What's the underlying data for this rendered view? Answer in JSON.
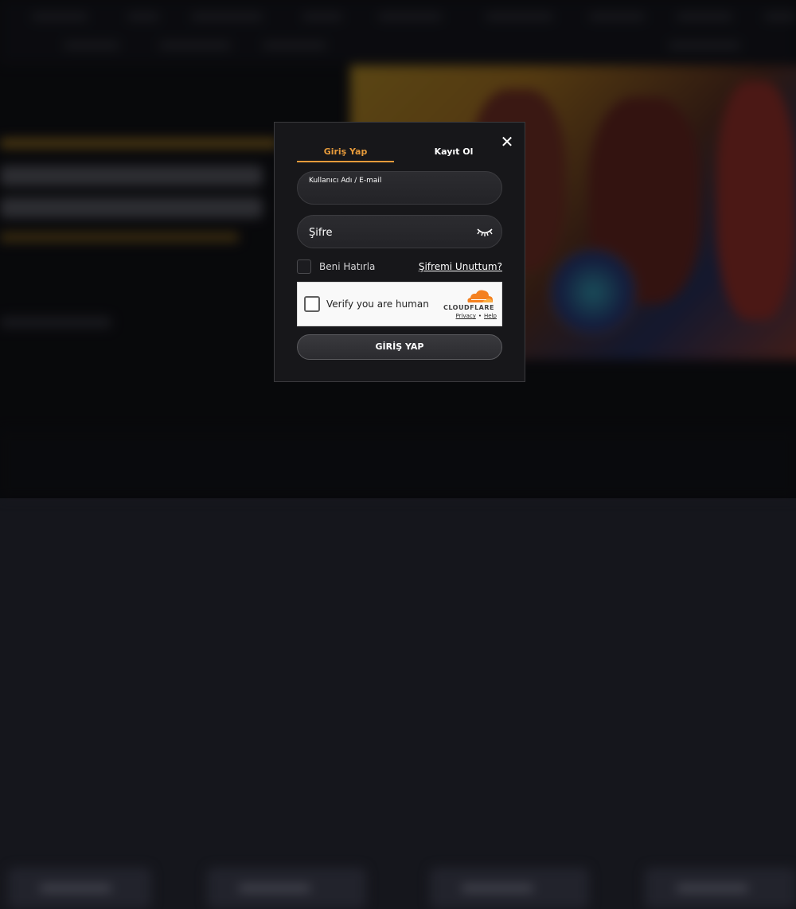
{
  "modal": {
    "tabs": [
      {
        "label": "Giriş Yap",
        "active": true
      },
      {
        "label": "Kayıt Ol",
        "active": false
      }
    ],
    "close_icon": "close-icon",
    "username_field": {
      "label": "Kullanıcı Adı / E-mail",
      "value": ""
    },
    "password_field": {
      "placeholder": "Şifre",
      "value": "",
      "icon": "eye-closed-icon"
    },
    "remember_label": "Beni Hatırla",
    "remember_checked": false,
    "forgot_link": "Şifremi Unuttum?",
    "captcha": {
      "text": "Verify you are human",
      "brand": "CLOUDFLARE",
      "privacy": "Privacy",
      "separator": "•",
      "help": "Help",
      "checked": false
    },
    "submit_label": "GİRİŞ YAP"
  },
  "colors": {
    "accent": "#e59a3b",
    "modal_bg": "#17171a",
    "cloudflare_orange": "#f48120"
  }
}
